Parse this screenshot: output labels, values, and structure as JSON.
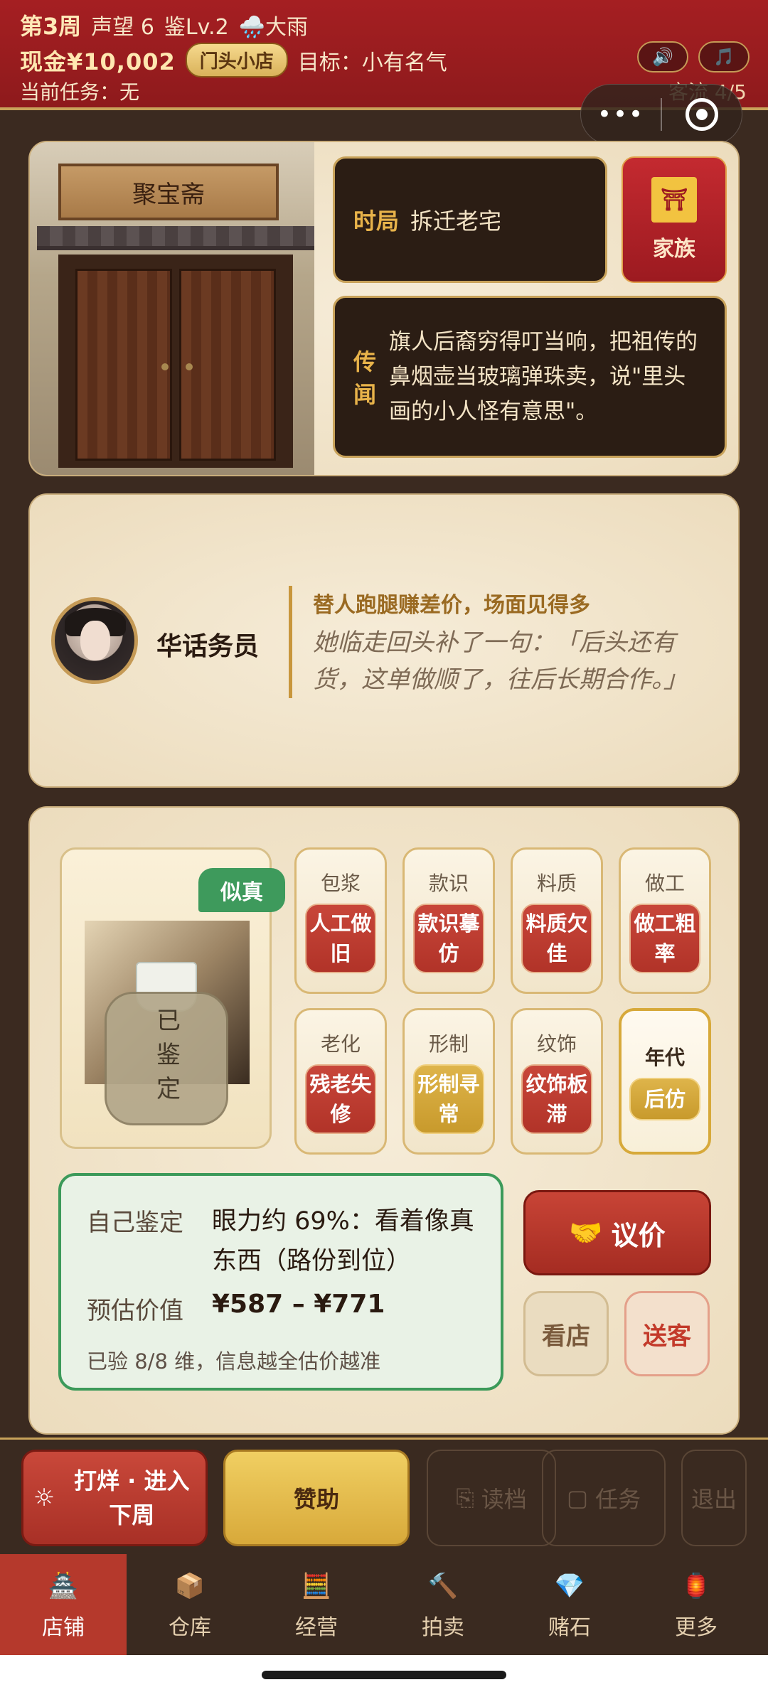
{
  "header": {
    "week": "第3周",
    "reputation": "声望 6",
    "appraisal_level": "鉴Lv.2",
    "weather_icon": "rain-cloud-icon",
    "weather": "🌧️大雨",
    "cash": "现金¥10,002",
    "shop_level": "门头小店",
    "goal": "目标：小有名气",
    "current_task": "当前任务：无",
    "guest_flow": "客流 4/5",
    "sound_icon": "🔊",
    "music_icon": "🎵",
    "capsule_more": "•••"
  },
  "store": {
    "sign": "聚宝斋",
    "situation_label": "时局",
    "situation_value": "拆迁老宅",
    "family_label": "家族",
    "rumor_label": "传闻",
    "rumor_text": "旗人后裔穷得叮当响，把祖传的鼻烟壶当玻璃弹珠卖，说\"里头画的小人怪有意思\"。"
  },
  "customer": {
    "name": "华话务员",
    "tag": "替人跑腿赚差价，场面见得多",
    "quote": "她临走回头补了一句：「后头还有货，这单做顺了，往后长期合作。」"
  },
  "item": {
    "authenticity_tag": "似真",
    "identified_stamp": "已鉴定"
  },
  "attributes": [
    {
      "name": "包浆",
      "value": "人工做旧"
    },
    {
      "name": "款识",
      "value": "款识摹仿"
    },
    {
      "name": "料质",
      "value": "料质欠佳"
    },
    {
      "name": "做工",
      "value": "做工粗率"
    },
    {
      "name": "老化",
      "value": "残老失修"
    },
    {
      "name": "形制",
      "value": "形制寻常"
    },
    {
      "name": "纹饰",
      "value": "纹饰板滞"
    },
    {
      "name": "年代",
      "value": "后仿"
    }
  ],
  "judgment": {
    "self_label": "自己鉴定",
    "self_text": "眼力约 69%：看着像真东西（路份到位）",
    "estimate_label": "预估价值",
    "estimate_value": "¥587 – ¥771",
    "note": "已验 8/8 维，信息越全估价越准"
  },
  "buttons": {
    "negotiate": "议价",
    "negotiate_icon": "🤝",
    "look_shop": "看店",
    "send_off": "送客"
  },
  "actions": {
    "next_week": "打烊 · 进入下周",
    "next_week_icon": "☼",
    "sponsor": "赞助",
    "load": "读档",
    "load_icon": "⎘",
    "task": "任务",
    "task_icon": "▢",
    "exit": "退出"
  },
  "tabs": [
    {
      "label": "店铺",
      "icon": "🏯"
    },
    {
      "label": "仓库",
      "icon": "📦"
    },
    {
      "label": "经营",
      "icon": "🧮"
    },
    {
      "label": "拍卖",
      "icon": "🔨"
    },
    {
      "label": "赌石",
      "icon": "💎"
    },
    {
      "label": "更多",
      "icon": "🏮"
    }
  ],
  "colors": {
    "header_red": "#a51f22",
    "gold": "#c8a25a",
    "real_green": "#3e9a5c",
    "attr_red": "#b13328",
    "tab_active": "#b5392c"
  }
}
